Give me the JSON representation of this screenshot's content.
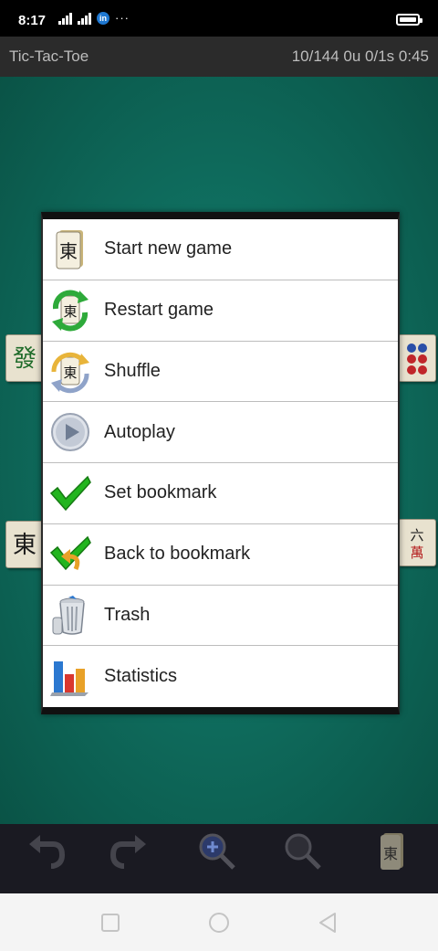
{
  "status_bar": {
    "time": "8:17",
    "dots": "···",
    "linkedin": "in",
    "icons": [
      "signal-icon",
      "signal-icon",
      "linkedin-icon",
      "more-dots-icon",
      "battery-icon"
    ]
  },
  "title_bar": {
    "app_title": "Tic-Tac-Toe",
    "status": "10/144 0u 0/1s 0:45"
  },
  "menu": {
    "items": [
      {
        "label": "Start new game",
        "icon": "mahjong-tile-icon"
      },
      {
        "label": "Restart game",
        "icon": "restart-icon"
      },
      {
        "label": "Shuffle",
        "icon": "shuffle-icon"
      },
      {
        "label": "Autoplay",
        "icon": "play-icon"
      },
      {
        "label": "Set bookmark",
        "icon": "checkmark-icon"
      },
      {
        "label": "Back to bookmark",
        "icon": "back-to-bookmark-icon"
      },
      {
        "label": "Trash",
        "icon": "trash-icon"
      },
      {
        "label": "Statistics",
        "icon": "statistics-icon"
      }
    ]
  },
  "board": {
    "tiles": [
      {
        "name": "green-dragon-tile",
        "glyph": "發",
        "color": "#1f6b2a"
      },
      {
        "name": "east-wind-tile",
        "glyph": "東",
        "color": "#1a1a1a"
      },
      {
        "name": "six-circles-tile",
        "glyph": "",
        "color": "#b52020"
      },
      {
        "name": "six-bamboo-tile",
        "glyph": "六萬",
        "color": "#b52020"
      }
    ]
  },
  "toolbar": {
    "buttons": [
      {
        "name": "undo-button",
        "icon": "undo-icon"
      },
      {
        "name": "redo-button",
        "icon": "redo-icon"
      },
      {
        "name": "zoom-in-button",
        "icon": "zoom-in-icon"
      },
      {
        "name": "zoom-fit-button",
        "icon": "zoom-icon"
      },
      {
        "name": "tile-menu-button",
        "icon": "mahjong-tile-icon"
      }
    ]
  },
  "nav_bar": {
    "buttons": [
      "recents-button",
      "home-button",
      "back-button"
    ]
  },
  "colors": {
    "board": "#0f6e5f",
    "title_bar": "#2b2b2b",
    "toolbar": "#1a1a22",
    "check_green": "#22b51e"
  }
}
